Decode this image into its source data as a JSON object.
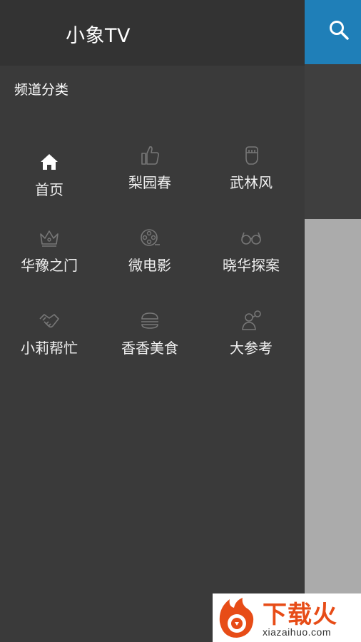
{
  "app": {
    "title": "小象TV"
  },
  "drawer": {
    "section_title": "频道分类",
    "channels": [
      {
        "label": "首页",
        "icon": "home-icon",
        "selected": true
      },
      {
        "label": "梨园春",
        "icon": "thumbs-up-icon",
        "selected": false
      },
      {
        "label": "武林风",
        "icon": "fist-icon",
        "selected": false
      },
      {
        "label": "华豫之门",
        "icon": "crown-icon",
        "selected": false
      },
      {
        "label": "微电影",
        "icon": "film-reel-icon",
        "selected": false
      },
      {
        "label": "晓华探案",
        "icon": "glasses-icon",
        "selected": false
      },
      {
        "label": "小莉帮忙",
        "icon": "handshake-icon",
        "selected": false
      },
      {
        "label": "香香美食",
        "icon": "burger-icon",
        "selected": false
      },
      {
        "label": "大参考",
        "icon": "speaker-icon",
        "selected": false
      }
    ]
  },
  "toolbar": {
    "search_icon": "search-icon"
  },
  "watermark": {
    "text": "下载火",
    "url": "xiazaihuo.com"
  },
  "colors": {
    "accent": "#1f7fb8",
    "drawer_bg": "#3a3a3a",
    "header_bg": "#333333",
    "icon_selected": "#ffffff",
    "icon_dim": "#777777"
  }
}
